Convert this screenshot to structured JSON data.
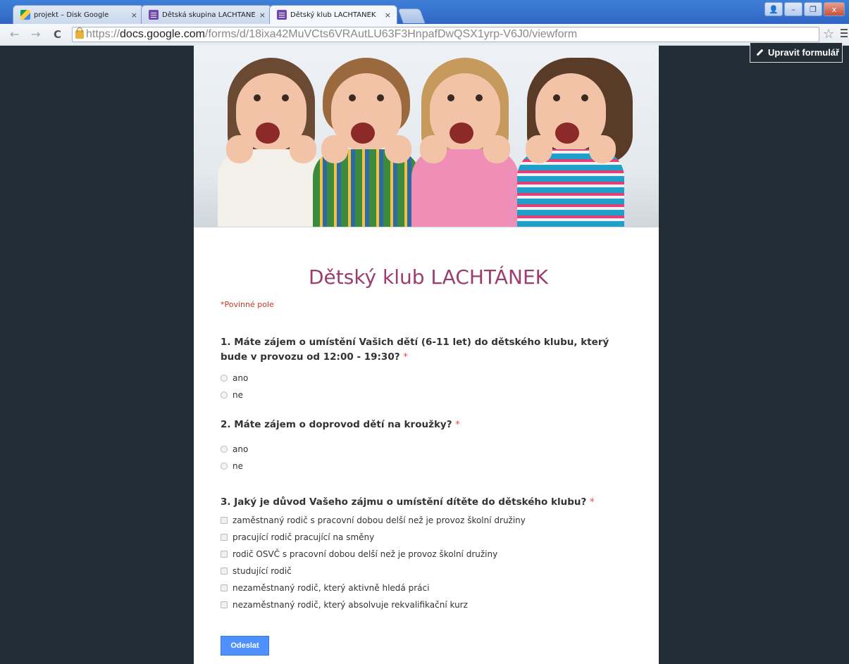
{
  "browser": {
    "tabs": [
      {
        "title": "projekt – Disk Google",
        "icon": "google-drive-icon",
        "close": "×"
      },
      {
        "title": "Dětská skupina LACHTÁNEK",
        "icon": "google-forms-icon",
        "close": "×"
      },
      {
        "title": "Dětský klub LACHTÁNEK",
        "icon": "google-forms-icon",
        "close": "×",
        "active": true
      }
    ],
    "window_buttons": {
      "user": "👤",
      "minimize": "–",
      "restore": "❐",
      "close": "x"
    },
    "nav": {
      "back": "←",
      "forward": "→",
      "reload": "C"
    },
    "url": {
      "scheme": "https://",
      "host": "docs.google.com",
      "path": "/forms/d/18ixa42MuVCts6VRAutLU63F3HnpafDwQSX1yrp-V6J0/viewform"
    },
    "bookmark": "☆"
  },
  "edit_button": {
    "label": "Upravit formulář"
  },
  "form": {
    "title": "Dětský klub LACHTÁNEK",
    "required_note": "*Povinné pole",
    "questions": [
      {
        "title": "1. Máte zájem o umístění Vašich dětí (6-11 let) do dětského klubu, který bude v provozu od 12:00 - 19:30?",
        "required_mark": "*",
        "type": "radio",
        "options": [
          "ano",
          "ne"
        ]
      },
      {
        "title": "2. Máte zájem o doprovod dětí na kroužky?",
        "required_mark": "*",
        "type": "radio",
        "options": [
          "ano",
          "ne"
        ]
      },
      {
        "title": "3. Jaký je důvod Vašeho zájmu o umístění dítěte do dětského klubu?",
        "required_mark": "*",
        "type": "checkbox",
        "options": [
          "zaměstnaný rodič s pracovní dobou delší než je provoz školní družiny",
          "pracující rodič pracující na směny",
          "rodič OSVČ s pracovní dobou delší než je provoz školní družiny",
          "studující rodič",
          "nezaměstnaný rodič, který aktivně hledá práci",
          "nezaměstnaný rodič, který absolvuje rekvalifikační kurz"
        ]
      }
    ],
    "submit_label": "Odeslat"
  },
  "colors": {
    "page_background": "#232d36",
    "title": "#9b3d6e",
    "required": "#c0392b",
    "submit": "#4d90fe"
  }
}
